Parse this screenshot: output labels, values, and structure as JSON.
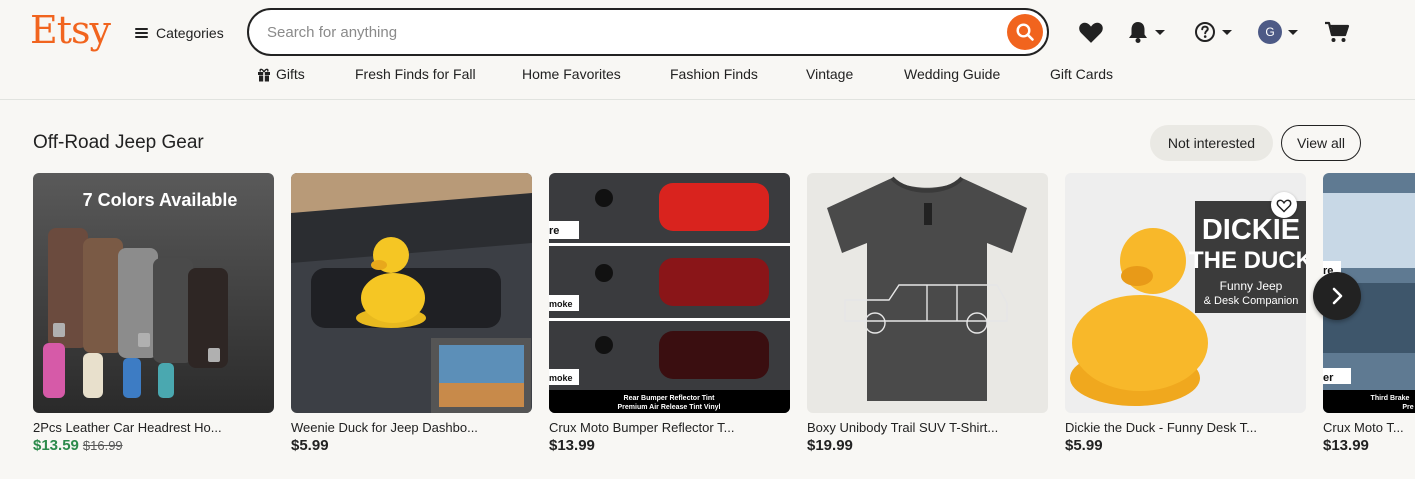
{
  "header": {
    "logo": "Etsy",
    "categories_label": "Categories",
    "search_placeholder": "Search for anything",
    "avatar_initial": "G"
  },
  "nav": {
    "items": [
      "Gifts",
      "Fresh Finds for Fall",
      "Home Favorites",
      "Fashion Finds",
      "Vintage",
      "Wedding Guide",
      "Gift Cards"
    ]
  },
  "section": {
    "title": "Off-Road Jeep Gear",
    "not_interested": "Not interested",
    "view_all": "View all"
  },
  "products": [
    {
      "title": "2Pcs Leather Car Headrest Ho...",
      "price": "$13.59",
      "original_price": "$16.99",
      "image_text": "7 Colors Available"
    },
    {
      "title": "Weenie Duck for Jeep Dashbo...",
      "price": "$5.99"
    },
    {
      "title": "Crux Moto Bumper Reflector T...",
      "price": "$13.99",
      "image_labels": [
        "re",
        "moke",
        "moke"
      ],
      "image_caption_1": "Rear Bumper Reflector Tint",
      "image_caption_2": "Premium Air Release Tint Vinyl"
    },
    {
      "title": "Boxy Unibody Trail SUV T-Shirt...",
      "price": "$19.99"
    },
    {
      "title": "Dickie the Duck - Funny Desk T...",
      "price": "$5.99",
      "image_text_1": "DICKIE",
      "image_text_2": "THE DUCK",
      "image_text_3": "Funny Jeep",
      "image_text_4": "& Desk Companion"
    },
    {
      "title": "Crux Moto T...",
      "price": "$13.99",
      "image_labels": [
        "re",
        "er"
      ],
      "image_caption_1": "Third Brake",
      "image_caption_2": "Pre"
    }
  ],
  "colors": {
    "brand": "#f1641e",
    "sale_price": "#2c8a4b",
    "background": "#f8f7f4"
  },
  "icons": [
    "menu-icon",
    "search-icon",
    "heart-icon",
    "bell-icon",
    "help-icon",
    "cart-icon",
    "gift-icon",
    "chevron-right-icon"
  ]
}
